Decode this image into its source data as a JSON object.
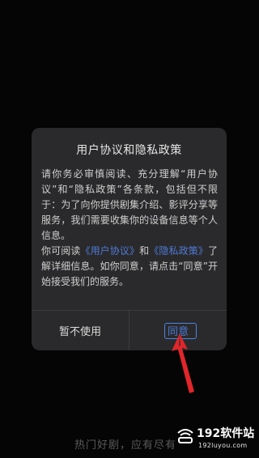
{
  "dialog": {
    "title": "用户协议和隐私政策",
    "paragraph1": "请你务必审慎阅读、充分理解“用户协议”和“隐私政策”各条款，包括但不限于：为了向你提供剧集介绍、影评分享等服务，我们需要收集你的设备信息等个人信息。",
    "paragraph2_prefix": "你可阅读",
    "link_user_agreement": "《用户协议》",
    "paragraph2_and": "和",
    "link_privacy_policy": "《隐私政策》",
    "paragraph2_suffix": "了解详细信息。如你同意，请点击“同意”开始接受我们的服务。",
    "decline_label": "暂不使用",
    "agree_label": "同意"
  },
  "background": {
    "caption": "热门好剧，应有尽有"
  },
  "watermark": {
    "brand": "192软件站",
    "url": "192luyou.com"
  },
  "colors": {
    "dialog_bg": "#2a2a2c",
    "link": "#4f7ad6",
    "arrow": "#e0262b"
  },
  "icons": {
    "annotation_arrow": "red-arrow-icon",
    "watermark_logo": "router-logo-icon"
  }
}
